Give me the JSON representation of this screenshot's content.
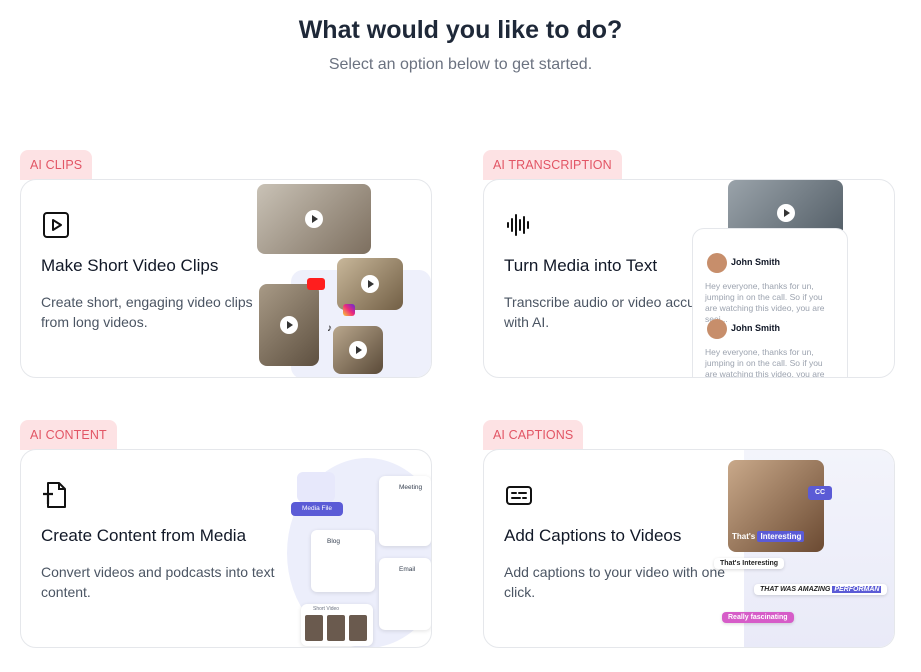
{
  "header": {
    "title": "What would you like to do?",
    "subtitle": "Select an option below to get started."
  },
  "cards": [
    {
      "tag": "AI CLIPS",
      "title": "Make Short Video Clips",
      "description": "Create short, engaging video clips from long videos.",
      "icon": "play-square-icon"
    },
    {
      "tag": "AI TRANSCRIPTION",
      "title": "Turn Media into Text",
      "description": "Transcribe audio or video accurately with AI.",
      "icon": "audio-wave-icon",
      "chat": [
        {
          "name": "John Smith",
          "text": "Hey everyone, thanks for un, jumping in on the call. So if you are watching this video, you are seei..."
        },
        {
          "name": "John Smith",
          "text": "Hey everyone, thanks for un, jumping in on the call. So if you are watching this video, you are see..."
        }
      ]
    },
    {
      "tag": "AI CONTENT",
      "title": "Create Content from Media",
      "description": "Convert videos and podcasts into text content.",
      "icon": "document-text-icon",
      "labels": {
        "media_file": "Media File",
        "meeting": "Meeting",
        "blog": "Blog",
        "email": "Email",
        "short_video": "Short Video"
      }
    },
    {
      "tag": "AI CAPTIONS",
      "title": "Add Captions to Videos",
      "description": "Add captions to your video with one click.",
      "icon": "captions-icon",
      "labels": {
        "cc": "CC",
        "that": "That's",
        "interesting": "Interesting",
        "caption2": "That's Interesting",
        "caption3": "THAT WAS AMAZING",
        "caption3b": "PERFORMAN",
        "caption4": "Really fascinating"
      }
    }
  ],
  "colors": {
    "tag_bg": "#fde2e4",
    "tag_text": "#e25565",
    "accent": "#5b5bd6"
  }
}
